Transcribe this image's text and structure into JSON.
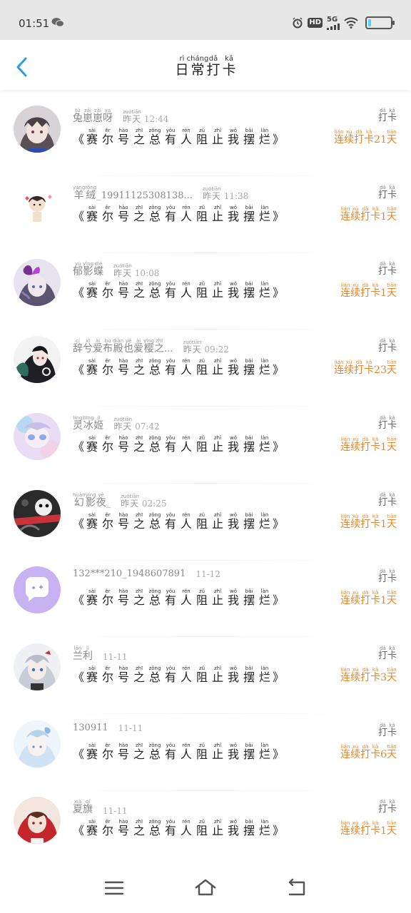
{
  "status": {
    "time": "01:51",
    "hd": "HD",
    "network": "5G"
  },
  "header": {
    "title": [
      {
        "py": "rì",
        "hz": "日"
      },
      {
        "py": "cháng",
        "hz": "常"
      },
      {
        "py": "dǎ",
        "hz": "打"
      },
      {
        "py": "kǎ",
        "hz": "卡"
      }
    ]
  },
  "colors": {
    "accent": "#2a9fe6",
    "streak": "#e8842a"
  },
  "message": [
    {
      "py": "sài",
      "hz": "赛"
    },
    {
      "py": "ěr",
      "hz": "尔"
    },
    {
      "py": "hào",
      "hz": "号"
    },
    {
      "py": "zhī",
      "hz": "之"
    },
    {
      "py": "zǒng",
      "hz": "总"
    },
    {
      "py": "yǒu",
      "hz": "有"
    },
    {
      "py": "rén",
      "hz": "人"
    },
    {
      "py": "zǔ",
      "hz": "阻"
    },
    {
      "py": "zhǐ",
      "hz": "止"
    },
    {
      "py": "wǒ",
      "hz": "我"
    },
    {
      "py": "bǎi",
      "hz": "摆"
    },
    {
      "py": "làn",
      "hz": "烂"
    }
  ],
  "checkin_label": [
    {
      "py": "dǎ",
      "hz": "打"
    },
    {
      "py": "kǎ",
      "hz": "卡"
    }
  ],
  "streak_prefix": [
    {
      "py": "lián",
      "hz": "连"
    },
    {
      "py": "xù",
      "hz": "续"
    },
    {
      "py": "dǎ",
      "hz": "打"
    },
    {
      "py": "kǎ",
      "hz": "卡"
    }
  ],
  "streak_suffix": {
    "py": "tiān",
    "hz": "天"
  },
  "yesterday": [
    {
      "py": "zuó",
      "hz": "昨"
    },
    {
      "py": "tiān",
      "hz": "天"
    }
  ],
  "items": [
    {
      "name": [
        {
          "py": "tù",
          "hz": "兔"
        },
        {
          "py": "zǎi",
          "hz": "崽"
        },
        {
          "py": "zǎi",
          "hz": "崽"
        },
        {
          "py": "ya",
          "hz": "呀"
        }
      ],
      "time": "12:44",
      "yesterday": true,
      "days": "21",
      "avatar": "girl-gray"
    },
    {
      "name": [
        {
          "py": "yáng",
          "hz": "羊"
        },
        {
          "py": "róng",
          "hz": "绒"
        }
      ],
      "name_suffix": "_19911125308138...",
      "time": "11:38",
      "yesterday": true,
      "days": "1",
      "avatar": "chibi"
    },
    {
      "name": [
        {
          "py": "yù",
          "hz": "郁"
        },
        {
          "py": "yǐng",
          "hz": "影"
        },
        {
          "py": "dié",
          "hz": "蝶"
        }
      ],
      "time": "10:08",
      "yesterday": true,
      "days": "1",
      "avatar": "butterfly"
    },
    {
      "name": [
        {
          "py": "cí",
          "hz": "辞"
        },
        {
          "py": "xī",
          "hz": "兮"
        },
        {
          "py": "ài",
          "hz": "爱"
        },
        {
          "py": "bù",
          "hz": "布"
        },
        {
          "py": "diàn",
          "hz": "殿"
        },
        {
          "py": "yě",
          "hz": "也"
        },
        {
          "py": "ài",
          "hz": "爱"
        },
        {
          "py": "yīng",
          "hz": "樱"
        },
        {
          "py": "zhī",
          "hz": "之"
        }
      ],
      "name_suffix": "...",
      "time": "09:22",
      "yesterday": true,
      "days": "23",
      "avatar": "dark-hair"
    },
    {
      "name": [
        {
          "py": "líng",
          "hz": "灵"
        },
        {
          "py": "bīng",
          "hz": "冰"
        },
        {
          "py": "jī",
          "hz": "姬"
        }
      ],
      "time": "07:42",
      "yesterday": true,
      "days": "1",
      "avatar": "pastel"
    },
    {
      "name": [
        {
          "py": "huàn",
          "hz": "幻"
        },
        {
          "py": "yǐng",
          "hz": "影"
        },
        {
          "py": "yè",
          "hz": "夜"
        }
      ],
      "name_suffix": "_",
      "time": "02:25",
      "yesterday": true,
      "days": "1",
      "avatar": "monochrome"
    },
    {
      "plain_name": "132***210_1948607891",
      "time": "11-12",
      "yesterday": false,
      "days": "1",
      "avatar": "chat-bubble"
    },
    {
      "name": [
        {
          "py": "lán",
          "hz": "兰"
        },
        {
          "py": "lì",
          "hz": "利"
        }
      ],
      "time": "11-11",
      "yesterday": false,
      "days": "3",
      "avatar": "silver"
    },
    {
      "plain_name": "130911",
      "time": "11-11",
      "yesterday": false,
      "days": "6",
      "avatar": "lightblue"
    },
    {
      "name": [
        {
          "py": "xià",
          "hz": "夏"
        },
        {
          "py": "qí",
          "hz": "旗"
        }
      ],
      "time": "11-11",
      "yesterday": false,
      "days": "1",
      "avatar": "red-hood"
    }
  ]
}
